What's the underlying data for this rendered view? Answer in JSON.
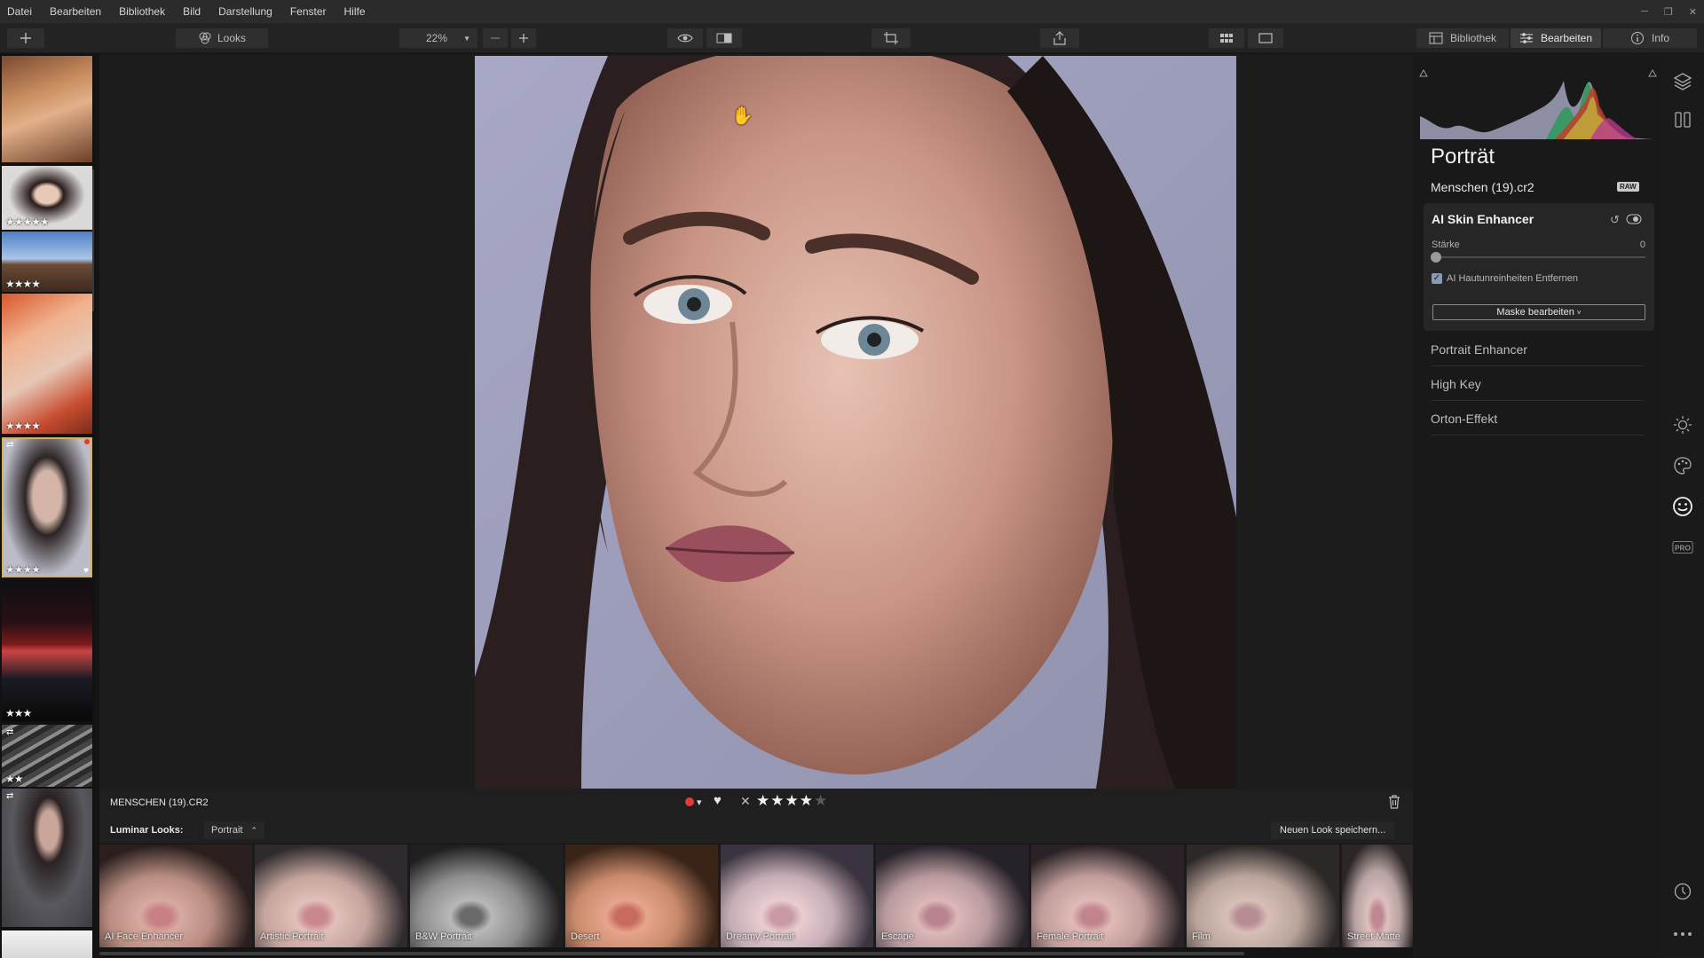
{
  "menu": [
    "Datei",
    "Bearbeiten",
    "Bibliothek",
    "Bild",
    "Darstellung",
    "Fenster",
    "Hilfe"
  ],
  "toolbar": {
    "looks_label": "Looks",
    "zoom_value": "22%",
    "tab_library": "Bibliothek",
    "tab_edit": "Bearbeiten",
    "tab_info": "Info"
  },
  "filmstrip": [
    {
      "stars": "",
      "rating": 0
    },
    {
      "stars": "★★★★★",
      "rating": 5
    },
    {
      "stars": "★★★★",
      "rating": 4
    },
    {
      "stars": "★★★★",
      "rating": 4
    },
    {
      "stars": "★★★★",
      "rating": 4
    },
    {
      "stars": "★★★",
      "rating": 3
    },
    {
      "stars": "★★",
      "rating": 2
    },
    {
      "stars": "",
      "rating": 0
    },
    {
      "stars": "",
      "rating": 0
    }
  ],
  "image_bar": {
    "filename": "MENSCHEN (19).CR2",
    "rating": 4,
    "stars_filled": "★★★★",
    "stars_empty": "★"
  },
  "looks_bar": {
    "label": "Luminar Looks:",
    "category": "Portrait",
    "save_button": "Neuen Look speichern..."
  },
  "looks": [
    "AI Face Enhancer",
    "Artistic Portrait",
    "B&W Portrait",
    "Desert",
    "Dreamy Portrait",
    "Escape",
    "Female Portrait",
    "Film",
    "Street Matte"
  ],
  "panel": {
    "title": "Porträt",
    "filename": "Menschen (19).cr2",
    "raw_badge": "RAW",
    "tool_name": "AI Skin Enhancer",
    "slider_label": "Stärke",
    "slider_value": "0",
    "checkbox_label": "AI Hautunreinheiten Entfernen",
    "checkbox_checked": true,
    "mask_button": "Maske bearbeiten",
    "subtools": [
      "Portrait Enhancer",
      "High Key",
      "Orton-Effekt"
    ]
  },
  "icons": [
    "layers-icon",
    "presets-icon",
    "sun-icon",
    "palette-icon",
    "face-icon",
    "pro-badge-icon",
    "history-icon",
    "more-icon"
  ]
}
